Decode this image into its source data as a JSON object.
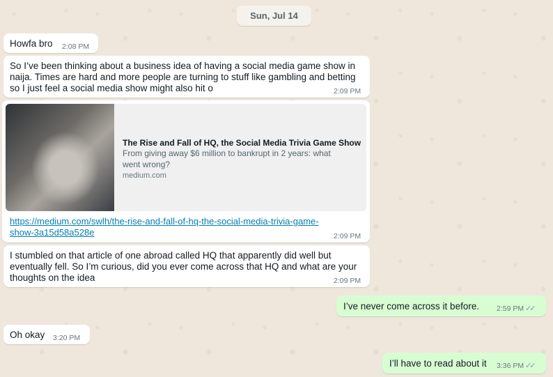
{
  "chat": {
    "date_separator": "Sun, Jul 14",
    "messages": [
      {
        "direction": "in",
        "text": "Howfa bro",
        "time": "2:08 PM"
      },
      {
        "direction": "in",
        "lines": [
          "So I’ve been thinking about a business idea of having a social media game show in",
          "naija. Times are hard and more people are turning to stuff like gambling and betting",
          "so I just feel a social media show might also hit o"
        ],
        "time": "2:09 PM"
      },
      {
        "direction": "in",
        "link_preview": {
          "title": "The Rise and Fall of HQ, the Social Media Trivia Game Show",
          "description_lines": [
            "From giving away $6 million to bankrupt in 2 years: what",
            "went wrong?"
          ],
          "domain": "medium.com"
        },
        "link_lines": [
          "https://medium.com/swlh/the-rise-and-fall-of-hq-the-social-media-trivia-game-",
          "show-3a15d58a528e"
        ],
        "time": "2:09 PM"
      },
      {
        "direction": "in",
        "lines": [
          "I stumbled on that article of one abroad called HQ that apparently did well but",
          "eventually fell. So I’m curious, did you ever come across that HQ and what are your",
          "thoughts on the idea"
        ],
        "time": "2:09 PM"
      },
      {
        "direction": "out",
        "text": "I’ve never come across it before.",
        "time": "2:59 PM",
        "status": "read"
      },
      {
        "direction": "in",
        "text": "Oh okay",
        "time": "3:20 PM"
      },
      {
        "direction": "out",
        "text": "I’ll have to read about it",
        "time": "3:36 PM",
        "status": "read"
      }
    ]
  },
  "icons": {
    "read_receipt": "double-check-icon"
  },
  "colors": {
    "incoming_bubble": "#ffffff",
    "outgoing_bubble": "#d9fdd3",
    "link": "#027eb5",
    "background": "#efe7dc"
  }
}
